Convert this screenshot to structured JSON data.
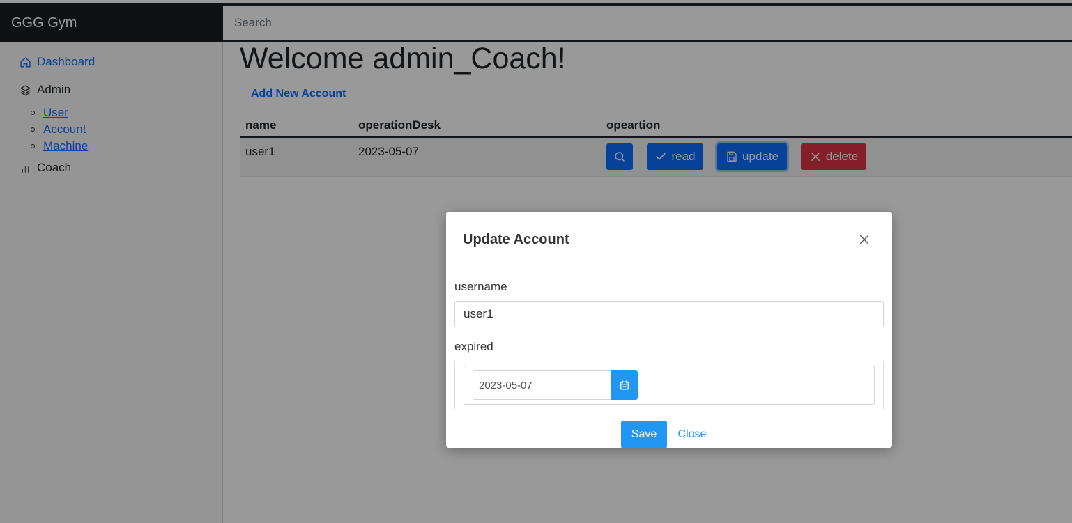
{
  "navbar": {
    "brand": "GGG Gym",
    "search_placeholder": "Search"
  },
  "sidebar": {
    "dashboard": "Dashboard",
    "admin": "Admin",
    "admin_items": [
      "User",
      "Account",
      "Machine"
    ],
    "coach": "Coach"
  },
  "main": {
    "title": "Welcome admin_Coach!",
    "add_link": "Add New Account",
    "columns": [
      "name",
      "operationDesk",
      "opeartion"
    ],
    "rows": [
      {
        "name": "user1",
        "operationDesk": "2023-05-07"
      }
    ],
    "buttons": {
      "read": "read",
      "update": "update",
      "delete": "delete"
    }
  },
  "modal": {
    "title": "Update Account",
    "username_label": "username",
    "username_value": "user1",
    "expired_label": "expired",
    "expired_value": "2023-05-07",
    "save": "Save",
    "close": "Close"
  },
  "colors": {
    "primary": "#0d6efd",
    "danger": "#dc3545",
    "modal_primary": "#2196f3",
    "navbar": "#212529"
  }
}
